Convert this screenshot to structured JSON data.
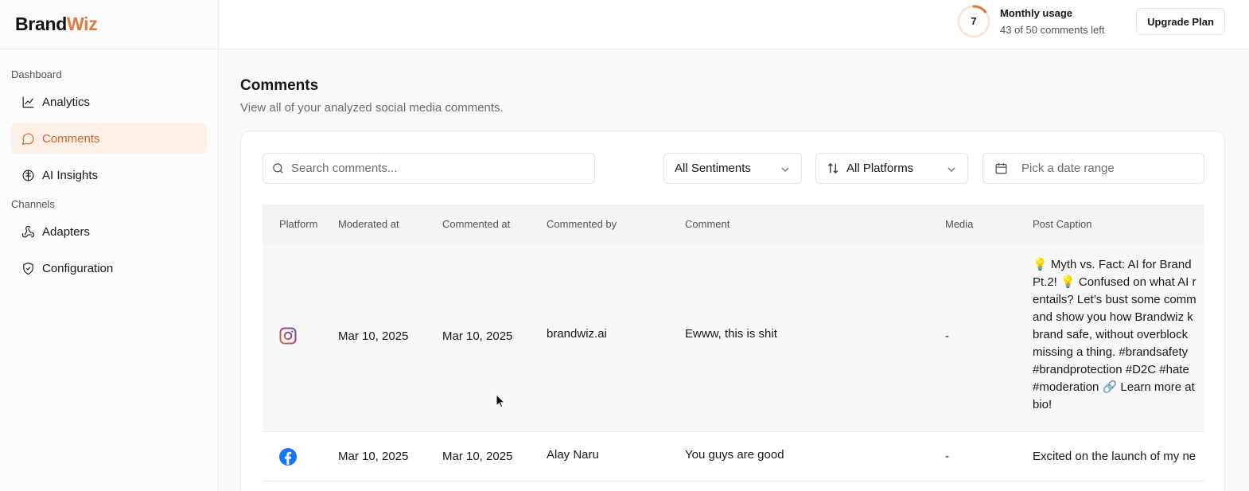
{
  "brand": {
    "name_part1": "Brand",
    "name_part2": "Wiz",
    "accent": "#e07a3e"
  },
  "sidebar": {
    "groups": [
      {
        "label": "Dashboard"
      },
      {
        "label": "Channels"
      }
    ],
    "items": [
      {
        "label": "Analytics",
        "icon": "chart-line-icon",
        "active": false
      },
      {
        "label": "Comments",
        "icon": "message-circle-icon",
        "active": true
      },
      {
        "label": "AI Insights",
        "icon": "brain-icon",
        "active": false
      },
      {
        "label": "Adapters",
        "icon": "webhook-icon",
        "active": false
      },
      {
        "label": "Configuration",
        "icon": "shield-check-icon",
        "active": false
      }
    ]
  },
  "header": {
    "usage": {
      "count": "7",
      "title": "Monthly usage",
      "subtitle": "43 of 50 comments left",
      "used_fraction": 0.14
    },
    "upgrade_label": "Upgrade Plan"
  },
  "page": {
    "title": "Comments",
    "subtitle": "View all of your analyzed social media comments."
  },
  "filters": {
    "search_placeholder": "Search comments...",
    "sentiment": "All Sentiments",
    "platform": "All Platforms",
    "date_placeholder": "Pick a date range"
  },
  "table": {
    "columns": [
      "Platform",
      "Moderated at",
      "Commented at",
      "Commented by",
      "Comment",
      "Media",
      "Post Caption"
    ],
    "rows": [
      {
        "platform": "instagram",
        "moderated_at": "Mar 10, 2025",
        "commented_at": "Mar 10, 2025",
        "commented_by": "brandwiz.ai",
        "comment": "Ewww, this is shit",
        "media": "-",
        "caption": "💡 Myth vs. Fact: AI for Brand\nPt.2! 💡 Confused on what AI r\nentails? Let’s bust some comm\nand show you how Brandwiz k\nbrand safe, without overblock\nmissing a thing. #brandsafety\n#brandprotection #D2C #hate\n#moderation 🔗 Learn more at\nbio!"
      },
      {
        "platform": "facebook",
        "moderated_at": "Mar 10, 2025",
        "commented_at": "Mar 10, 2025",
        "commented_by": "Alay Naru",
        "comment": "You guys are good",
        "media": "-",
        "caption": "Excited on the launch of my ne"
      }
    ]
  }
}
